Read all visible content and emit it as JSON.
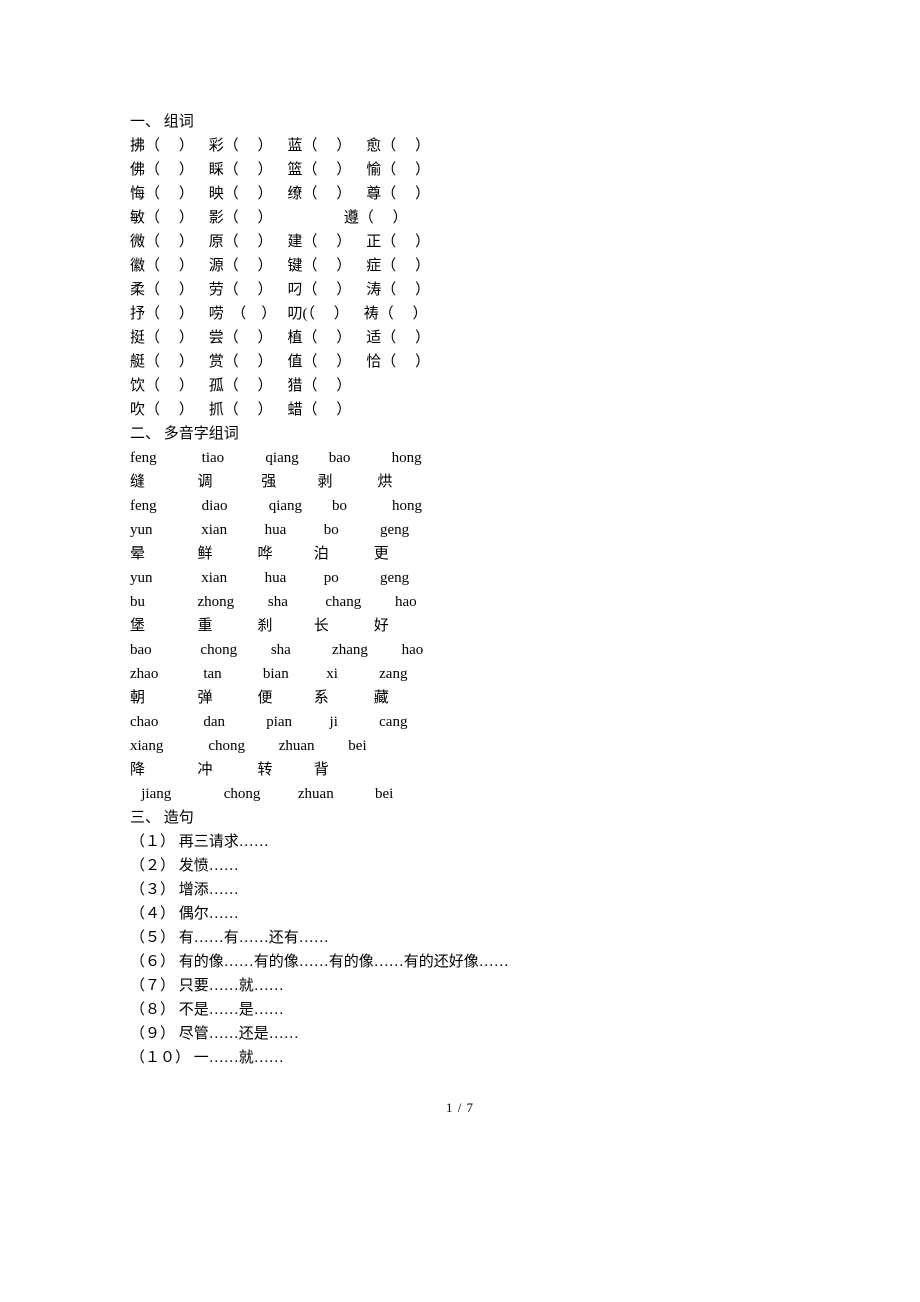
{
  "sections": {
    "one_title": "一、 组词",
    "one_rows": [
      "拂（     ）    彩（     ）    蓝（     ）    愈（     ）",
      "佛（     ）    睬（     ）    篮（     ）    愉（     ）",
      "",
      "悔（     ）    映（     ）    缭（     ）    尊（     ）",
      "敏（     ）    影（     ）                   遵（     ）",
      "",
      "微（     ）    原（     ）    建（     ）    正（     ）",
      "徽（     ）    源（     ）    键（     ）    症（     ）",
      "",
      "柔（     ）    劳（     ）    叼（     ）    涛（     ）",
      "抒（     ）    唠  （    ）   叨(（     ）    祷（     ）",
      "",
      "挺（     ）    尝（     ）    植（     ）    适（     ）",
      "艇（     ）    赏（     ）    值（     ）    恰（     ）",
      "",
      "饮（     ）    孤（     ）    猎（     ）",
      "吹（     ）    抓（     ）    蜡（     ）"
    ],
    "two_title": "二、 多音字组词",
    "two_rows": [
      "feng            tiao           qiang        bao           hong",
      "缝              调             强           剥            烘",
      "feng            diao           qiang        bo            hong",
      "yun             xian          hua          bo           geng",
      "晕              鲜            哗           泊            更",
      "yun             xian          hua          po           geng",
      "bu              zhong         sha          chang         hao",
      "堡              重            刹           长            好",
      "bao             chong         sha           zhang         hao",
      "zhao            tan           bian          xi           zang",
      "朝              弹            便           系            藏",
      "chao            dan           pian          ji           cang",
      "xiang            chong         zhuan         bei",
      "降              冲            转           背",
      "   jiang              chong          zhuan           bei"
    ],
    "three_title": "三、 造句",
    "three_rows": [
      "（１） 再三请求……",
      "（２） 发愤……",
      "（３） 增添……",
      "（４） 偶尔……",
      "（５） 有……有……还有……",
      "（６） 有的像……有的像……有的像……有的还好像……",
      "（７） 只要……就……",
      "（８） 不是……是……",
      "（９） 尽管……还是……",
      "（１０） 一……就……"
    ]
  },
  "footer": "1 / 7"
}
